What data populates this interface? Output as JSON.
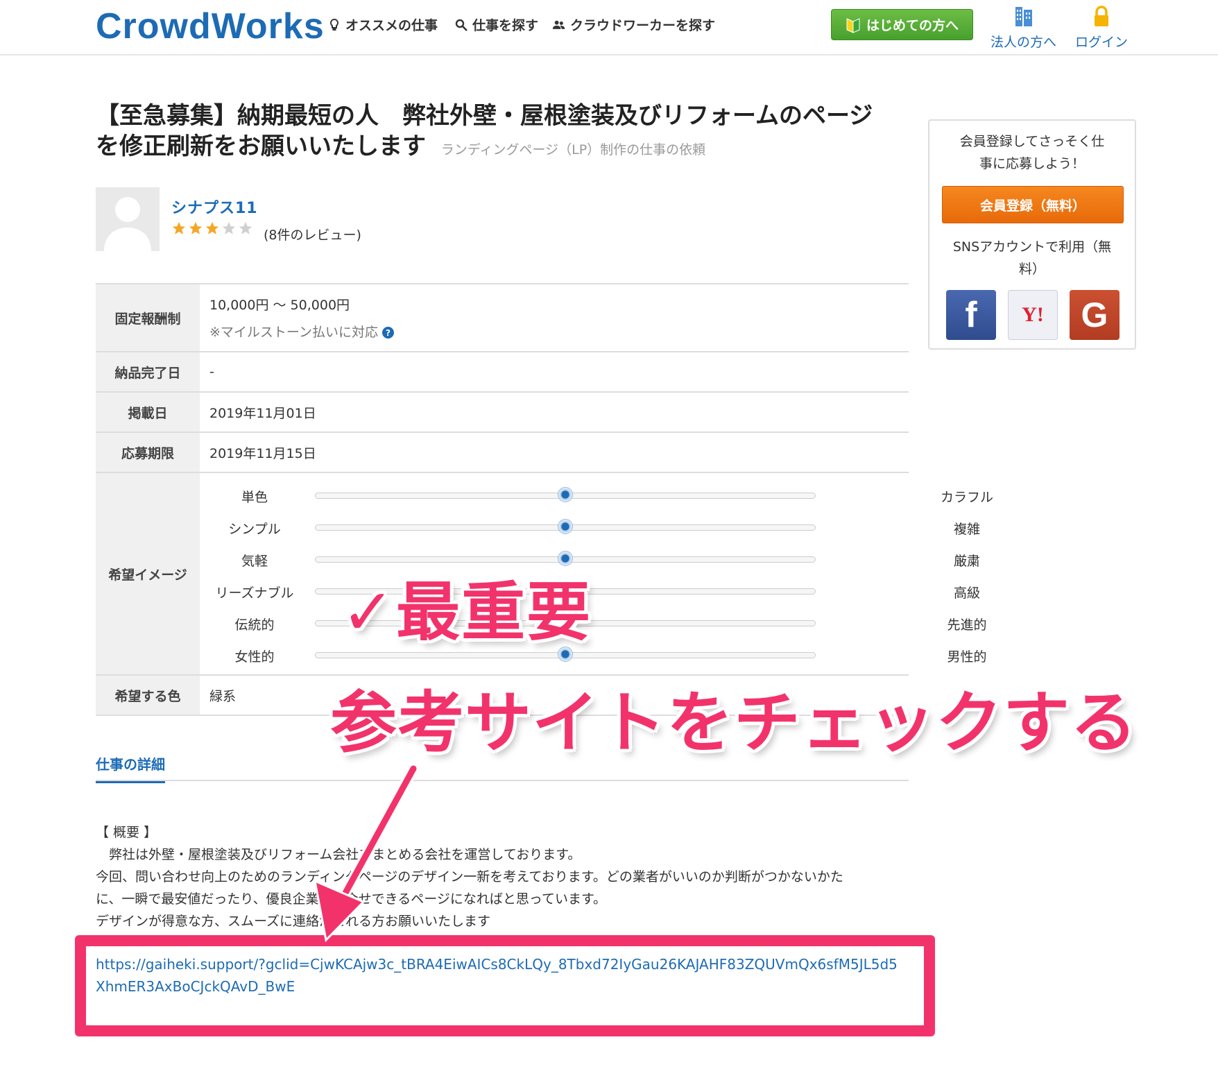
{
  "header": {
    "logo": "CrowdWorks",
    "nav": [
      {
        "label": "オススメの仕事",
        "icon": "lightbulb-icon"
      },
      {
        "label": "仕事を探す",
        "icon": "search-icon"
      },
      {
        "label": "クラウドワーカーを探す",
        "icon": "users-icon"
      }
    ],
    "beginner_button": "はじめての方へ",
    "corporate_link": "法人の方へ",
    "login_link": "ログイン"
  },
  "job": {
    "title": "【至急募集】納期最短の人　弊社外壁・屋根塗装及びリフォームのページを修正刷新をお願いいたします",
    "category": "ランディングページ（LP）制作の仕事の依頼"
  },
  "client": {
    "name": "シナプス11",
    "rating": 3,
    "rating_max": 5,
    "reviews": "(8件のレビュー)"
  },
  "table": {
    "fee_label": "固定報酬制",
    "fee_value": "10,000円 〜 50,000円",
    "fee_note": "※マイルストーン払いに対応",
    "delivery_label": "納品完了日",
    "delivery_value": "-",
    "posted_label": "掲載日",
    "posted_value": "2019年11月01日",
    "deadline_label": "応募期限",
    "deadline_value": "2019年11月15日",
    "image_label": "希望イメージ",
    "sliders": [
      {
        "left": "単色",
        "right": "カラフル",
        "value": 0.5
      },
      {
        "left": "シンプル",
        "right": "複雑",
        "value": 0.5
      },
      {
        "left": "気軽",
        "right": "厳粛",
        "value": 0.5
      },
      {
        "left": "リーズナブル",
        "right": "高級",
        "value": 0.5
      },
      {
        "left": "伝統的",
        "right": "先進的",
        "value": 0.5
      },
      {
        "left": "女性的",
        "right": "男性的",
        "value": 0.5
      }
    ],
    "color_label": "希望する色",
    "color_value": "緑系"
  },
  "details": {
    "tab": "仕事の詳細",
    "lines": [
      "【 概要 】",
      "　弊社は外壁・屋根塗装及びリフォーム会社をまとめる会社を運営しております。",
      "今回、問い合わせ向上のためのランディングページのデザイン一新を考えております。どの業者がいいのか判断がつかないかた",
      "に、一瞬で最安値だったり、優良企業と問合せできるページになればと思っています。",
      "デザインが得意な方、スムーズに連絡がとれる方お願いいたします"
    ],
    "url": "https://gaiheki.support/?gclid=CjwKCAjw3c_tBRA4EiwAICs8CkLQy_8Tbxd72IyGau26KAJAHF83ZQUVmQx6sfM5JL5d5XhmER3AxBoCJckQAvD_BwE"
  },
  "sidebar": {
    "prompt": "会員登録してさっそく仕事に応募しよう！",
    "register_button": "会員登録（無料）",
    "sns_text": "SNSアカウントで利用（無料）",
    "sns": [
      "f",
      "Y!",
      "G"
    ]
  },
  "annotations": {
    "important": "✓最重要",
    "check": "参考サイトをチェックする"
  },
  "colors": {
    "brand_blue": "#1d6bb5",
    "annotation_pink": "#f2336b",
    "register_orange": "#f5871f",
    "beginner_green": "#48a02d"
  }
}
